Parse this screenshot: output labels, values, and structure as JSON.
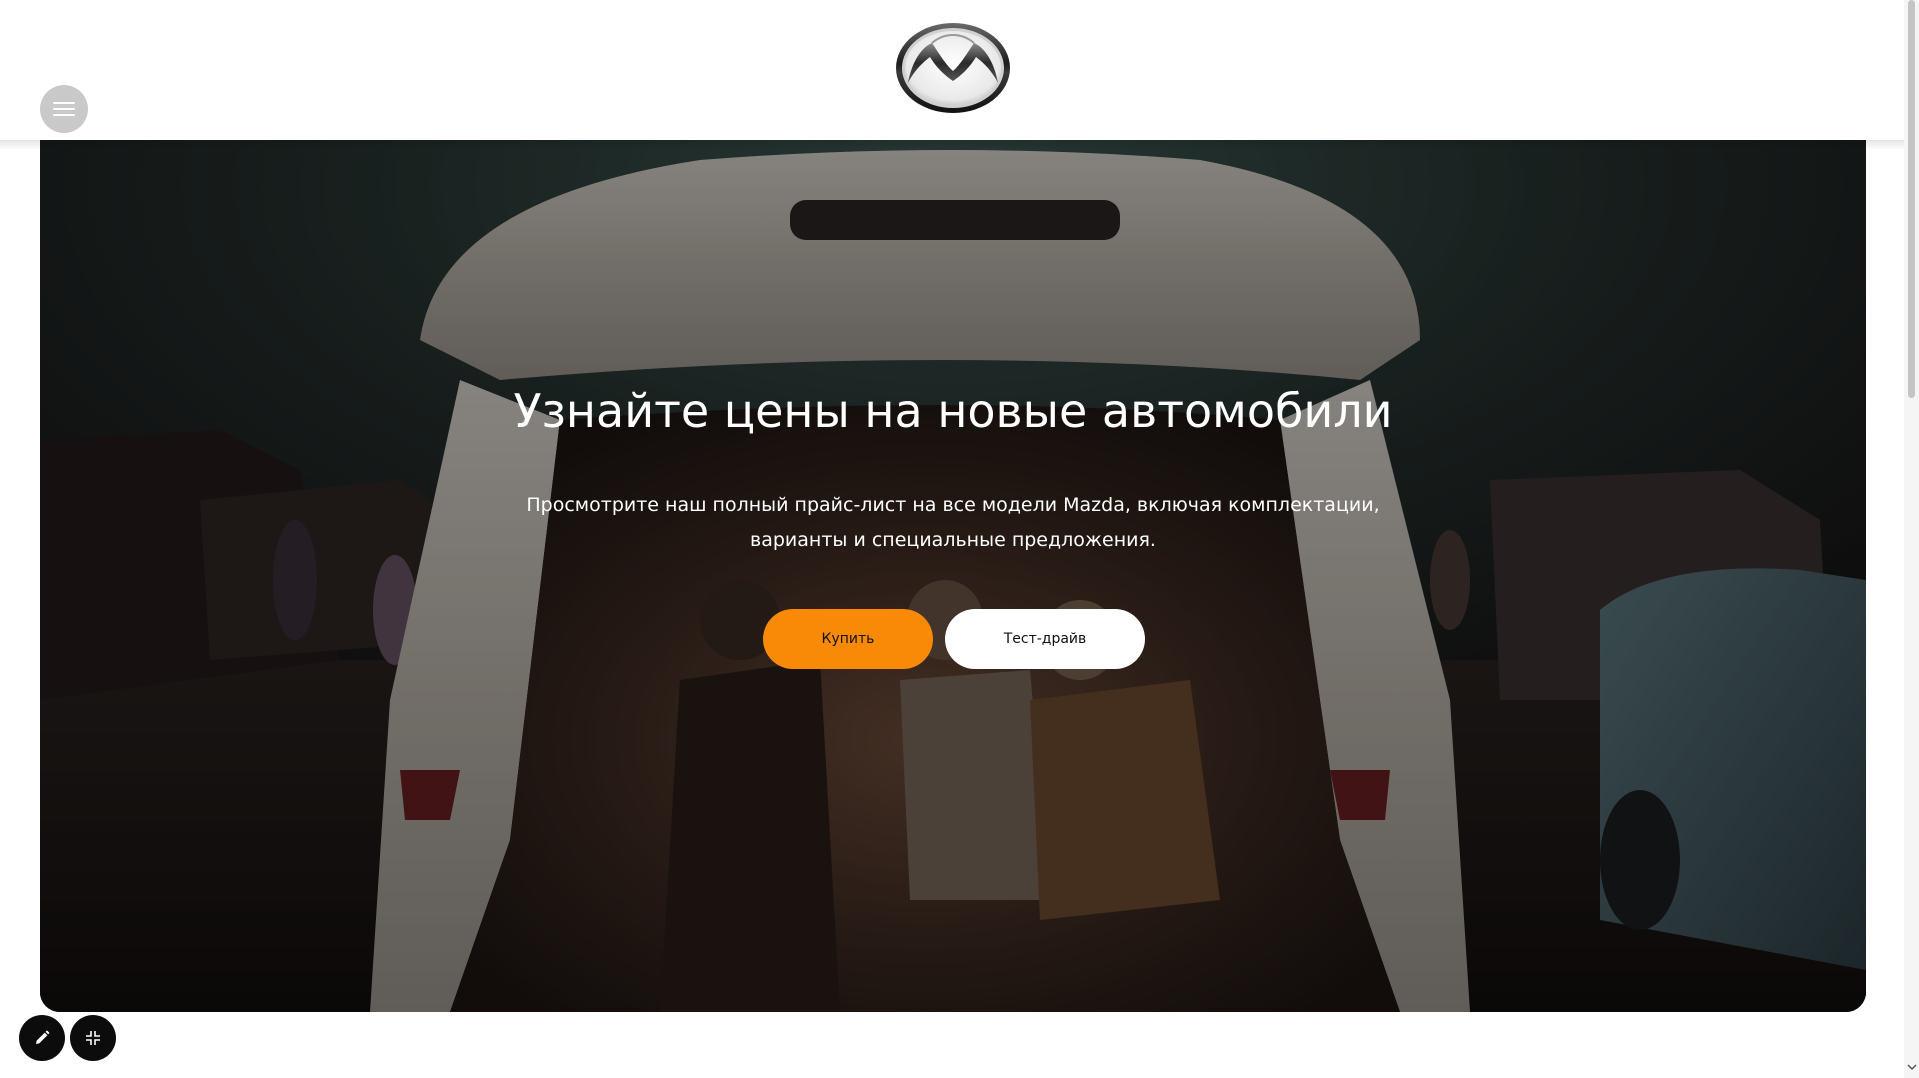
{
  "header": {
    "menu_icon": "hamburger-menu-icon",
    "logo_icon": "mazda-logo"
  },
  "hero": {
    "title": "Узнайте цены на новые автомобили",
    "subtitle": "Просмотрите наш полный прайс-лист на все модели Mazda, включая комплектации, варианты и специальные предложения.",
    "buy_label": "Купить",
    "test_drive_label": "Тест-драйв",
    "background_image": "people-sitting-in-car-trunk-at-drive-in-cinema-at-night"
  },
  "tools": {
    "edit_icon": "pencil-icon",
    "collapse_icon": "collapse-icon"
  },
  "colors": {
    "accent": "#f98a07",
    "header_bg": "#ffffff",
    "menu_button_bg": "#c9c9c9",
    "tool_button_bg": "#0c0c0c"
  }
}
